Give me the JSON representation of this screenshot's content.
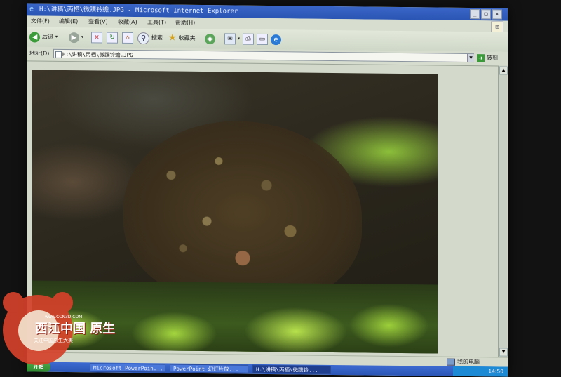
{
  "window": {
    "title": "H:\\讲稿\\丙栖\\微蹼铃蟾.JPG - Microsoft Internet Explorer",
    "buttons": [
      "_",
      "□",
      "×"
    ]
  },
  "menu": [
    "文件(F)",
    "编辑(E)",
    "查看(V)",
    "收藏(A)",
    "工具(T)",
    "帮助(H)"
  ],
  "toolbar": {
    "back_label": "后退",
    "search_label": "搜索",
    "favorites_label": "收藏夹"
  },
  "address": {
    "label": "地址(D)",
    "value": "H:\\讲稿\\丙栖\\微蹼铃蟾.JPG",
    "go_label": "转到"
  },
  "status": {
    "zone": "我的电脑"
  },
  "taskbar": {
    "start_label": "开始",
    "tasks": [
      "Microsoft PowerPoin...",
      "PowerPoint 幻灯片放...",
      "H:\\讲稿\\丙栖\\微蹼铃..."
    ],
    "clock": "14:50"
  },
  "watermark": {
    "text": "西江中国 原生",
    "url": "www.CCN3D.COM",
    "sub": "关注中国原生大美"
  },
  "colors": {
    "title_blue": "#2a55b4",
    "taskbar_blue": "#2b56b6",
    "start_green": "#2f8a2f",
    "watermark_red": "#d4412a"
  }
}
